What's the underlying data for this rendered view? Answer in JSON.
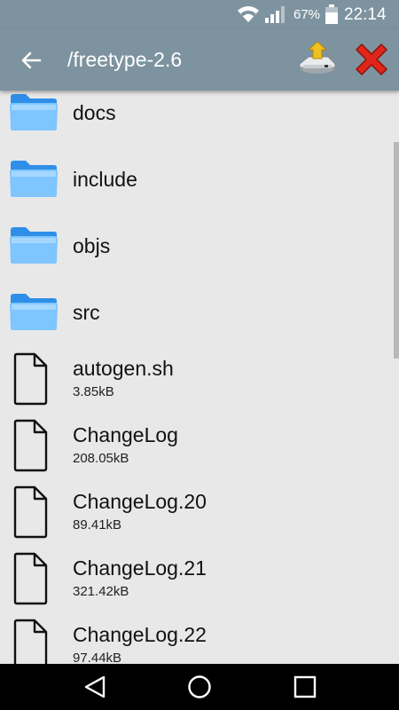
{
  "status_bar": {
    "battery_percent": "67%",
    "time": "22:14",
    "icons": [
      "wifi-icon",
      "signal-icon",
      "battery-icon"
    ]
  },
  "app_bar": {
    "title": "/freetype-2.6",
    "back_icon": "arrow-left-icon",
    "install_icon": "install-icon",
    "close_icon": "close-x-icon",
    "colors": {
      "bar": "#7d939f",
      "close": "#e0261b"
    }
  },
  "folders": [
    {
      "name": "docs"
    },
    {
      "name": "include"
    },
    {
      "name": "objs"
    },
    {
      "name": "src"
    }
  ],
  "files": [
    {
      "name": "autogen.sh",
      "size": "3.85kB"
    },
    {
      "name": "ChangeLog",
      "size": "208.05kB"
    },
    {
      "name": "ChangeLog.20",
      "size": "89.41kB"
    },
    {
      "name": "ChangeLog.21",
      "size": "321.42kB"
    },
    {
      "name": "ChangeLog.22",
      "size": "97.44kB"
    }
  ],
  "nav_bar": {
    "icons": [
      "back-triangle-icon",
      "home-circle-icon",
      "recents-square-icon"
    ]
  }
}
